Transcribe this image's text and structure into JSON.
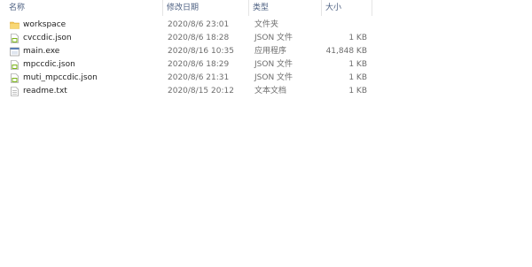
{
  "columns": {
    "name": "名称",
    "date": "修改日期",
    "type": "类型",
    "size": "大小"
  },
  "files": [
    {
      "name": "workspace",
      "date": "2020/8/6 23:01",
      "type": "文件夹",
      "size": "",
      "icon": "folder-icon"
    },
    {
      "name": "cvccdic.json",
      "date": "2020/8/6 18:28",
      "type": "JSON 文件",
      "size": "1 KB",
      "icon": "json-file-icon"
    },
    {
      "name": "main.exe",
      "date": "2020/8/16 10:35",
      "type": "应用程序",
      "size": "41,848 KB",
      "icon": "exe-file-icon"
    },
    {
      "name": "mpccdic.json",
      "date": "2020/8/6 18:29",
      "type": "JSON 文件",
      "size": "1 KB",
      "icon": "json-file-icon"
    },
    {
      "name": "muti_mpccdic.json",
      "date": "2020/8/6 21:31",
      "type": "JSON 文件",
      "size": "1 KB",
      "icon": "json-file-icon"
    },
    {
      "name": "readme.txt",
      "date": "2020/8/15 20:12",
      "type": "文本文档",
      "size": "1 KB",
      "icon": "text-file-icon"
    }
  ],
  "colors": {
    "header_text": "#4d6082",
    "folder": "#f3c75a",
    "json_accent": "#7ab317",
    "text_secondary": "#6d6d6d"
  }
}
